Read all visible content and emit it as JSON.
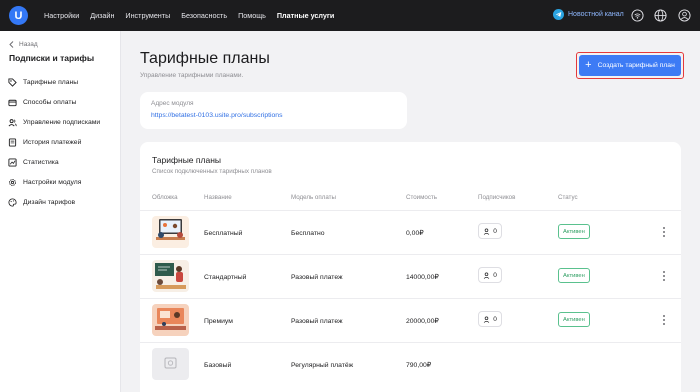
{
  "brand": {
    "logo_letter": "U"
  },
  "topnav": {
    "items": [
      {
        "label": "Настройки",
        "active": false
      },
      {
        "label": "Дизайн",
        "active": false
      },
      {
        "label": "Инструменты",
        "active": false
      },
      {
        "label": "Безопасность",
        "active": false
      },
      {
        "label": "Помощь",
        "active": false
      },
      {
        "label": "Платные услуги",
        "active": true
      }
    ],
    "channel_label": "Новостной канал",
    "right_icons": [
      "wifi-icon",
      "globe-icon",
      "account-icon"
    ]
  },
  "sidebar": {
    "back_label": "Назад",
    "title": "Подписки и тарифы",
    "items": [
      {
        "label": "Тарифные планы",
        "icon": "tag-icon"
      },
      {
        "label": "Способы оплаты",
        "icon": "wallet-icon"
      },
      {
        "label": "Управление подписками",
        "icon": "users-icon"
      },
      {
        "label": "История платежей",
        "icon": "receipt-icon"
      },
      {
        "label": "Статистика",
        "icon": "chart-icon"
      },
      {
        "label": "Настройки модуля",
        "icon": "gear-icon"
      },
      {
        "label": "Дизайн тарифов",
        "icon": "palette-icon"
      }
    ]
  },
  "page": {
    "title": "Тарифные планы",
    "subtitle": "Управление тарифными планами.",
    "create_button": "Создать тарифный план"
  },
  "module_address": {
    "label": "Адрес модуля",
    "url": "https://betatest-0103.usite.pro/subscriptions"
  },
  "plans": {
    "title": "Тарифные планы",
    "subtitle": "Список подключенных тарифных планов",
    "columns": {
      "cover": "Обложка",
      "name": "Название",
      "payment_model": "Модель оплаты",
      "price": "Стоимость",
      "subscribers": "Подписчиков",
      "status": "Статус"
    },
    "rows": [
      {
        "name": "Бесплатный",
        "payment_model": "Бесплатно",
        "price": "0,00₽",
        "subscribers": "0",
        "status": "Активен",
        "cover": "illustration-meeting"
      },
      {
        "name": "Стандартный",
        "payment_model": "Разовый платеж",
        "price": "14000,00₽",
        "subscribers": "0",
        "status": "Активен",
        "cover": "illustration-teacher"
      },
      {
        "name": "Премиум",
        "payment_model": "Разовый платеж",
        "price": "20000,00₽",
        "subscribers": "0",
        "status": "Активен",
        "cover": "illustration-study"
      },
      {
        "name": "Базовый",
        "payment_model": "Регулярный платёж",
        "price": "790,00₽",
        "subscribers": "",
        "status": "",
        "cover": "placeholder-image-icon"
      }
    ]
  },
  "colors": {
    "accent": "#3d7bf5",
    "topbar": "#1c1c1e",
    "status_green": "#2f9f63",
    "highlight_border": "#e5393b"
  }
}
